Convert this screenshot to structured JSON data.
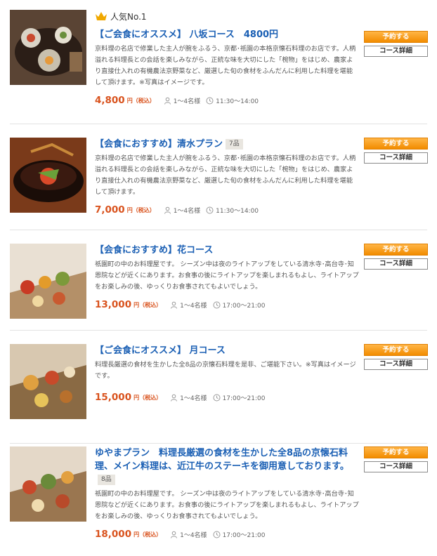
{
  "ranking_label": "人気No.1",
  "colors": {
    "title": "#1a5fb4",
    "price": "#d9531e",
    "reserve_button": "#f28c00"
  },
  "items": [
    {
      "title": "【ご会食にオススメ】 八坂コース　4800円",
      "tag": "",
      "description": "京料理の名店で修業した主人が腕をふるう、京都･祇園の本格京懐石料理のお店です。人柄溢れる料理長との会話を楽しみながら、正統な味を大切にした「椀物」をはじめ、農家より直接仕入れの有機農法京野菜など、厳選した旬の食材をふんだんに利用した料理を堪能して頂けます。※写真はイメージです。",
      "price": "4,800",
      "price_unit": "円（税込）",
      "guests": "1～4名様",
      "time": "11:30～14:00",
      "reserve_label": "予約する",
      "detail_label": "コース詳細"
    },
    {
      "title": "【会食におすすめ】清水プラン",
      "tag": "7品",
      "description": "京料理の名店で修業した主人が腕をふるう、京都･祇園の本格京懐石料理のお店です。人柄溢れる料理長との会話を楽しみながら、正統な味を大切にした「椀物」をはじめ、農家より直接仕入れの有機農法京野菜など、厳選した旬の食材をふんだんに利用した料理を堪能して頂けます。",
      "price": "7,000",
      "price_unit": "円（税込）",
      "guests": "1～4名様",
      "time": "11:30～14:00",
      "reserve_label": "予約する",
      "detail_label": "コース詳細"
    },
    {
      "title": "【会食におすすめ】花コース",
      "tag": "",
      "description": "祇園町の中のお料理屋です。 シーズン中は夜のライトアップをしている清水寺･高台寺･知恩院などが近くにあります。お食事の後にライトアップを楽しまれるもよし、ライトアップをお楽しみの後、ゆっくりお食事されてもよいでしょう。",
      "price": "13,000",
      "price_unit": "円（税込）",
      "guests": "1～4名様",
      "time": "17:00～21:00",
      "reserve_label": "予約する",
      "detail_label": "コース詳細"
    },
    {
      "title": "【ご会食にオススメ】 月コース",
      "tag": "",
      "description": "料理長厳選の食材を生かした全8品の京懐石料理を是非、ご堪能下さい。※写真はイメージです。",
      "price": "15,000",
      "price_unit": "円（税込）",
      "guests": "1～4名様",
      "time": "17:00～21:00",
      "reserve_label": "予約する",
      "detail_label": "コース詳細"
    },
    {
      "title": "ゆやまプラン　料理長厳選の食材を生かした全8品の京懐石料理、メイン料理は、近江牛のステーキを御用意しております。",
      "tag": "8品",
      "description": "祇園町の中のお料理屋です。 シーズン中は夜のライトアップをしている清水寺･高台寺･知恩院などが近くにあります。お食事の後にライトアップを楽しまれるもよし、ライトアップをお楽しみの後、ゆっくりお食事されてもよいでしょう。",
      "price": "18,000",
      "price_unit": "円（税込）",
      "guests": "1～4名様",
      "time": "17:00～21:00",
      "reserve_label": "予約する",
      "detail_label": "コース詳細"
    }
  ]
}
